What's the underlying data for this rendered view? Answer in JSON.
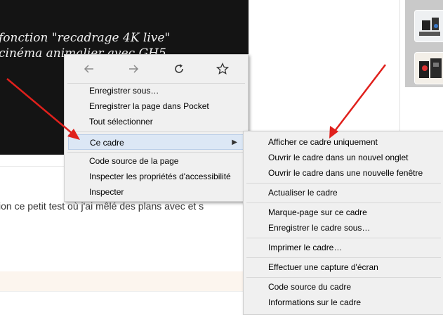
{
  "video_overlay": {
    "line1": "fonction \"recadrage 4K live\"",
    "line2": "cinéma animalier avec GH5"
  },
  "page": {
    "body_text": "ion ce petit test où j'ai mêlé des plans avec et s"
  },
  "context_menu": {
    "nav": {
      "back_icon": "arrow-left-icon",
      "forward_icon": "arrow-right-icon",
      "reload_icon": "reload-icon",
      "bookmark_icon": "star-icon"
    },
    "items": [
      "Enregistrer sous…",
      "Enregistrer la page dans Pocket",
      "Tout sélectionner",
      "Ce cadre",
      "Code source de la page",
      "Inspecter les propriétés d'accessibilité",
      "Inspecter"
    ]
  },
  "submenu": {
    "items": [
      "Afficher ce cadre uniquement",
      "Ouvrir le cadre dans un nouvel onglet",
      "Ouvrir le cadre dans une nouvelle fenêtre",
      "Actualiser le cadre",
      "Marque-page sur ce cadre",
      "Enregistrer le cadre sous…",
      "Imprimer le cadre…",
      "Effectuer une capture d'écran",
      "Code source du cadre",
      "Informations sur le cadre"
    ]
  },
  "colors": {
    "highlight": "#dce7f5",
    "menu_bg": "#f0f0f0",
    "annotation_arrow": "#e0201c"
  }
}
